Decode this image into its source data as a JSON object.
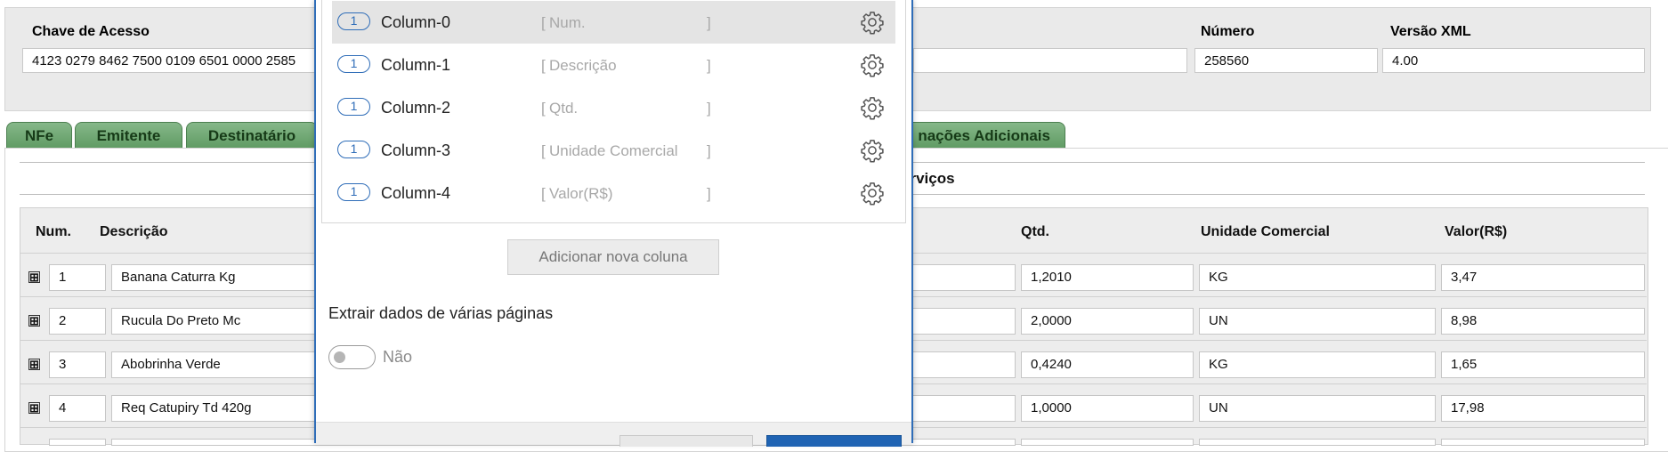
{
  "header": {
    "chave_label": "Chave de Acesso",
    "chave_value": "4123 0279 8462 7500 0109 6501 0000 2585",
    "numero_label": "Número",
    "numero_value": "258560",
    "versao_label": "Versão XML",
    "versao_value": "4.00"
  },
  "tabs": [
    {
      "label": "NFe"
    },
    {
      "label": "Emitente"
    },
    {
      "label": "Destinatário"
    },
    {
      "label": "nações Adicionais"
    }
  ],
  "section": {
    "title_fragment": "erviços"
  },
  "table": {
    "headers": {
      "num": "Num.",
      "descricao": "Descrição",
      "qtd": "Qtd.",
      "unidade": "Unidade Comercial",
      "valor": "Valor(R$)"
    },
    "rows": [
      {
        "num": "1",
        "descricao": "Banana Caturra Kg",
        "qtd": "1,2010",
        "unidade": "KG",
        "valor": "3,47"
      },
      {
        "num": "2",
        "descricao": "Rucula Do Preto Mc",
        "qtd": "2,0000",
        "unidade": "UN",
        "valor": "8,98"
      },
      {
        "num": "3",
        "descricao": "Abobrinha Verde",
        "qtd": "0,4240",
        "unidade": "KG",
        "valor": "1,65"
      },
      {
        "num": "4",
        "descricao": "Req Catupiry Td 420g",
        "qtd": "1,0000",
        "unidade": "UN",
        "valor": "17,98"
      }
    ],
    "expand_glyph": "⊞"
  },
  "modal": {
    "columns": [
      {
        "badge": "1",
        "name": "Column-0",
        "open": "[",
        "mapped": "Num.",
        "close": "]"
      },
      {
        "badge": "1",
        "name": "Column-1",
        "open": "[",
        "mapped": "Descrição",
        "close": "]"
      },
      {
        "badge": "1",
        "name": "Column-2",
        "open": "[",
        "mapped": "Qtd.",
        "close": "]"
      },
      {
        "badge": "1",
        "name": "Column-3",
        "open": "[",
        "mapped": "Unidade Comercial",
        "close": "]"
      },
      {
        "badge": "1",
        "name": "Column-4",
        "open": "[",
        "mapped": "Valor(R$)",
        "close": "]"
      }
    ],
    "add_column_label": "Adicionar nova coluna",
    "multi_page_title": "Extrair dados de várias páginas",
    "multi_page_toggle": "Não",
    "accent_color": "#2f6db8"
  },
  "colors": {
    "tab_green": "#5f9b63",
    "primary_button": "#1f63b3"
  }
}
